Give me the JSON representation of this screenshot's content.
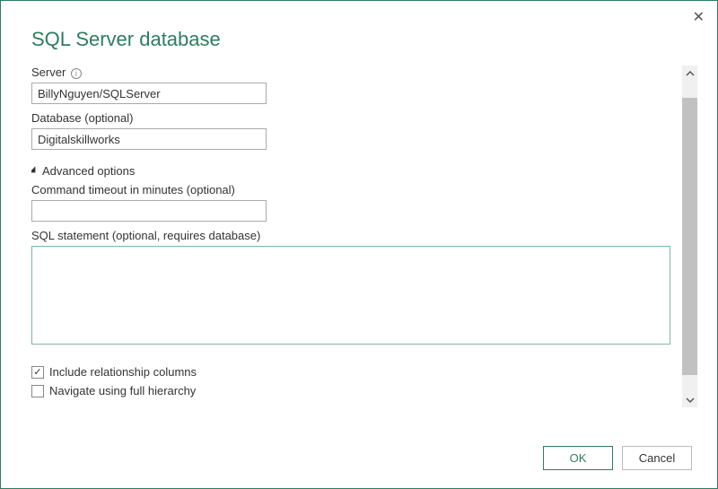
{
  "dialog": {
    "title": "SQL Server database"
  },
  "fields": {
    "server": {
      "label": "Server",
      "value": "BillyNguyen/SQLServer"
    },
    "database": {
      "label": "Database (optional)",
      "value": "Digitalskillworks"
    },
    "advanced_label": "Advanced options",
    "timeout": {
      "label": "Command timeout in minutes (optional)",
      "value": ""
    },
    "sql": {
      "label": "SQL statement (optional, requires database)",
      "value": ""
    }
  },
  "checkboxes": {
    "include_rel": {
      "label": "Include relationship columns",
      "checked": true
    },
    "navigate_full": {
      "label": "Navigate using full hierarchy",
      "checked": false
    }
  },
  "buttons": {
    "ok": "OK",
    "cancel": "Cancel"
  }
}
